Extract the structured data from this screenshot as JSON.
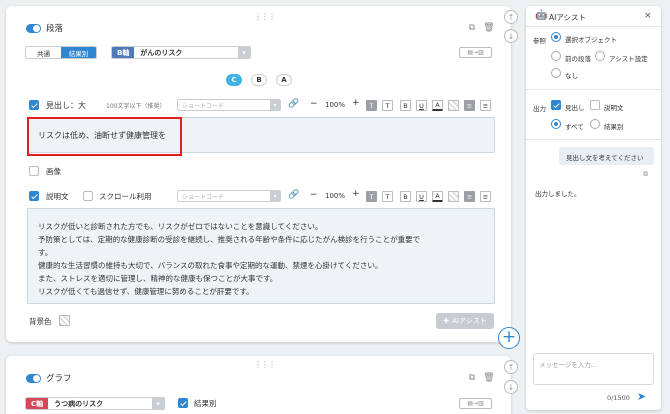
{
  "section1": {
    "title": "段落",
    "seg_options": [
      "共通",
      "結果別"
    ],
    "axis_tag": "B軸",
    "axis_value": "がんのリスク",
    "variants": [
      "C",
      "B",
      "A"
    ],
    "heading_label": "見出し：大",
    "heading_hint": "100文字以下（推奨）",
    "shortcode_placeholder": "ショートコード",
    "zoom": "100%",
    "heading_text": "リスクは低め、油断せず健康管理を",
    "image_label": "画像",
    "desc_label": "説明文",
    "scroll_label": "スクロール利用",
    "desc_lines": [
      "リスクが低いと診断された方でも、リスクがゼロではないことを意識してください。",
      "予防策としては、定期的な健康診断の受診を継続し、推奨される年齢や条件に応じたがん検診を行うことが重要で",
      "す。",
      "健康的な生活習慣の維持も大切で、バランスの取れた食事や定期的な運動、禁煙を心掛けてください。",
      "また、ストレスを適切に管理し、精神的な健康も保つことが大事です。",
      "リスクが低くても過信せず、健康管理に努めることが肝要です。"
    ],
    "bg_label": "背景色",
    "ai_assist_label": "AIアシスト"
  },
  "section2": {
    "title": "グラフ",
    "axis_tag": "C軸",
    "axis_value": "うつ病のリスク",
    "result_label": "結果別"
  },
  "toolbar": {
    "minus": "−",
    "plus": "+",
    "bold_t": "T",
    "t": "T",
    "b": "B",
    "u": "U",
    "a": "A"
  },
  "ai_panel": {
    "title": "AIアシスト",
    "ref_label": "参照",
    "ref_options": [
      "選択オブジェクト",
      "前の段落",
      "アシスト設定",
      "なし"
    ],
    "output_label": "出力",
    "output_checks": [
      "見出し",
      "説明文"
    ],
    "output_radios": [
      "すべて",
      "結果別"
    ],
    "user_msg": "見出し文を考えてください",
    "bot_msg": "出力しました。",
    "input_placeholder": "メッセージを入力...",
    "counter": "0/1500"
  },
  "colors": {
    "accent": "#2f86d1",
    "highlight": "#e02020"
  }
}
